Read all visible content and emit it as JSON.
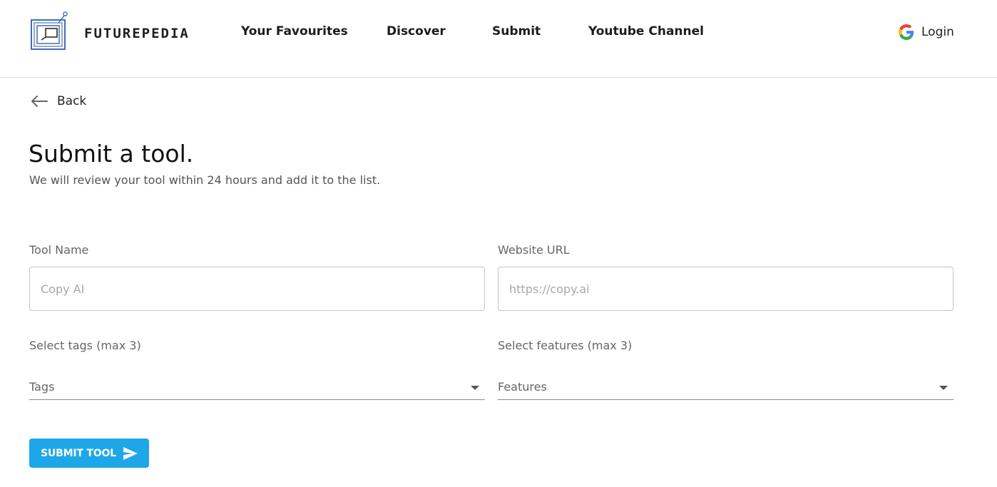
{
  "brand": {
    "name": "FUTUREPEDIA"
  },
  "nav": {
    "items": [
      {
        "label": "Your Favourites"
      },
      {
        "label": "Discover"
      },
      {
        "label": "Submit"
      },
      {
        "label": "Youtube Channel"
      }
    ],
    "login_label": "Login"
  },
  "back": {
    "label": "Back"
  },
  "page": {
    "title": "Submit a tool.",
    "subtitle": "We will review your tool within 24 hours and add it to the list."
  },
  "form": {
    "tool_name": {
      "label": "Tool Name",
      "placeholder": "Copy AI",
      "value": ""
    },
    "website_url": {
      "label": "Website URL",
      "placeholder": "https://copy.ai",
      "value": ""
    },
    "tags": {
      "label": "Select tags (max 3)",
      "placeholder": "Tags"
    },
    "features": {
      "label": "Select features (max 3)",
      "placeholder": "Features"
    },
    "submit_label": "SUBMIT TOOL"
  },
  "colors": {
    "accent": "#1ea7e8",
    "logo_blue": "#3f6fb5",
    "google_blue": "#4285F4",
    "google_red": "#EA4335",
    "google_yellow": "#FBBC05",
    "google_green": "#34A853"
  },
  "icons": [
    "futurepedia-logo-icon",
    "google-icon",
    "arrow-left-icon",
    "caret-down-icon",
    "send-icon"
  ]
}
